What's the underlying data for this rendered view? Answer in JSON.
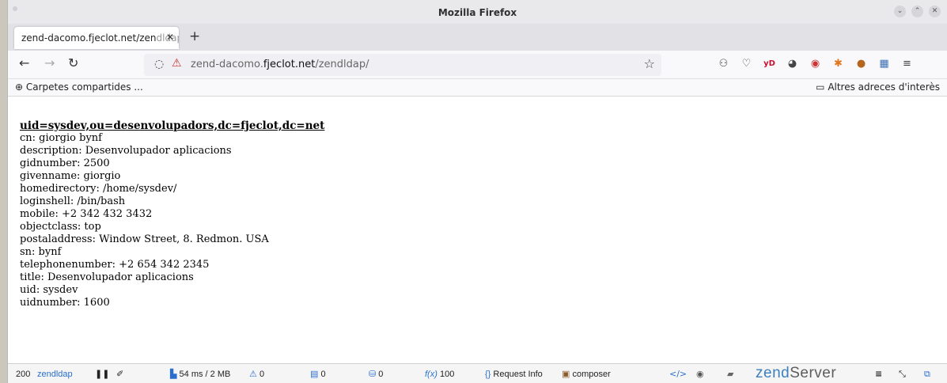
{
  "window": {
    "title": "Mozilla Firefox"
  },
  "tabs": [
    {
      "label": "zend-dacomo.fjeclot.net/zen",
      "label_fade": "dldap/"
    }
  ],
  "nav": {
    "url_host": "zend-dacomo.",
    "url_domain": "fjeclot.net",
    "url_path": "/zendldap/"
  },
  "bookmarks": {
    "left_label": "Carpetes compartides ...",
    "right_label": "Altres adreces d'interès"
  },
  "ldap_entry": {
    "dn": "uid=sysdev,ou=desenvolupadors,dc=fjeclot,dc=net",
    "attributes": [
      "cn: giorgio bynf",
      "description: Desenvolupador aplicacions",
      "gidnumber: 2500",
      "givenname: giorgio",
      "homedirectory: /home/sysdev/",
      "loginshell: /bin/bash",
      "mobile: +2 342 432 3432",
      "objectclass: top",
      "postaladdress: Window Street, 8. Redmon. USA",
      "sn: bynf",
      "telephonenumber: +2 654 342 2345",
      "title: Desenvolupador aplicacions",
      "uid: sysdev",
      "uidnumber: 1600"
    ]
  },
  "zend_toolbar": {
    "status_code": "200",
    "route": "zendldap",
    "time_memory": "54 ms / 2 MB",
    "warnings": "0",
    "logs": "0",
    "db": "0",
    "functions": "100",
    "request_info": "Request Info",
    "composer": "composer",
    "logo_zend": "zend",
    "logo_server": "Server"
  },
  "colors": {
    "accent": "#2a6fcf",
    "zend_logo": "#3d7fbf"
  }
}
